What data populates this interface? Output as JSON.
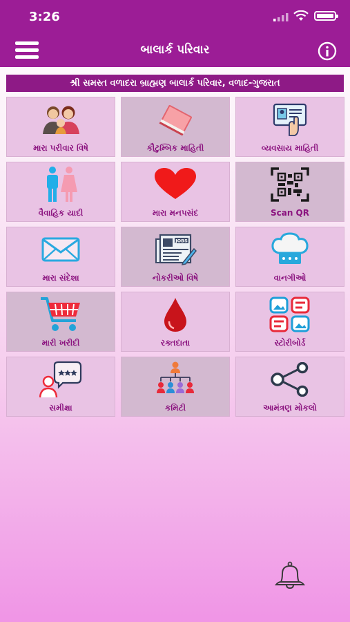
{
  "status_bar": {
    "time": "3:26"
  },
  "header": {
    "title": "બાલાર્ક પરિવાર"
  },
  "banner": {
    "text": "શ્રી સમસ્ત વળાદરા બ્રાહ્મણ બાલાર્ક પરિવાર, વળાદ-ગુજરાત"
  },
  "tiles": [
    {
      "label": "મારા પરીવાર વિષે",
      "icon": "family-icon"
    },
    {
      "label": "કૌટુમ્બિક માહિતી",
      "icon": "book-icon"
    },
    {
      "label": "વ્યવસાય માહિતી",
      "icon": "id-card-icon"
    },
    {
      "label": "વૈવાહિક યાદી",
      "icon": "man-woman-icon"
    },
    {
      "label": "મારા મનપસંદ",
      "icon": "heart-icon"
    },
    {
      "label": "Scan QR",
      "icon": "qr-code-icon"
    },
    {
      "label": "મારા સંદેશા",
      "icon": "envelope-icon"
    },
    {
      "label": "નોકરીઓ વિષે",
      "icon": "jobs-newspaper-icon"
    },
    {
      "label": "વાનગીઓ",
      "icon": "chef-hat-icon"
    },
    {
      "label": "મારી ખરીદી",
      "icon": "shopping-cart-icon"
    },
    {
      "label": "રક્તદાતા",
      "icon": "blood-drop-icon"
    },
    {
      "label": "સ્ટોરીબોર્ડ",
      "icon": "storyboard-icon"
    },
    {
      "label": "સમીક્ષા",
      "icon": "review-icon"
    },
    {
      "label": "કમિટી",
      "icon": "committee-icon"
    },
    {
      "label": "આમંત્રણ મોકલો",
      "icon": "share-icon"
    }
  ],
  "jobs_icon_text": "JOBS"
}
